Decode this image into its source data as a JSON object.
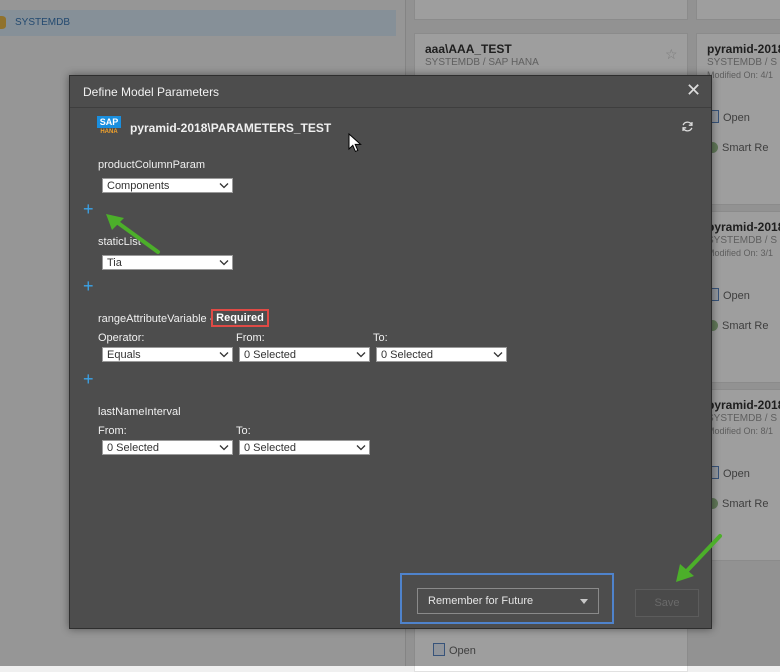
{
  "background": {
    "tree_item": "SYSTEMDB",
    "cards": [
      {
        "title": "aaa\\AAA_TEST",
        "subtitle": "SYSTEMDB / SAP HANA"
      },
      {
        "title": "pyramid-2018",
        "subtitle": "SYSTEMDB / S",
        "meta": "Modified On: 4/1"
      },
      {
        "title": "pyramid-2018",
        "subtitle": "SYSTEMDB / S",
        "meta": "Modified On: 3/1"
      },
      {
        "title": "pyramid-2018",
        "subtitle": "SYSTEMDB / S",
        "meta": "Modified On: 8/1"
      }
    ],
    "open_label": "Open",
    "smart_label": "Smart Re"
  },
  "modal": {
    "title": "Define Model Parameters",
    "close_icon": "close-icon",
    "logo": {
      "top": "SAP",
      "bottom": "HANA"
    },
    "model_name": "pyramid-2018\\PARAMETERS_TEST",
    "params": {
      "product": {
        "label": "productColumnParam",
        "value": "Components"
      },
      "static": {
        "label": "staticList",
        "value": "Tia"
      },
      "range": {
        "label": "rangeAttributeVariable -",
        "required": "Required",
        "operator_label": "Operator:",
        "operator_value": "Equals",
        "from_label": "From:",
        "from_value": "0 Selected",
        "to_label": "To:",
        "to_value": "0 Selected"
      },
      "lastname": {
        "label": "lastNameInterval",
        "from_label": "From:",
        "from_value": "0 Selected",
        "to_label": "To:",
        "to_value": "0 Selected"
      }
    },
    "add_symbol": "+",
    "remember": "Remember for Future",
    "ok_button": "Save"
  },
  "colors": {
    "accent": "#3ba3e8",
    "required_border": "#e04a45",
    "highlight_box": "#4f83cc",
    "annotation_arrow": "#4caf2a"
  }
}
